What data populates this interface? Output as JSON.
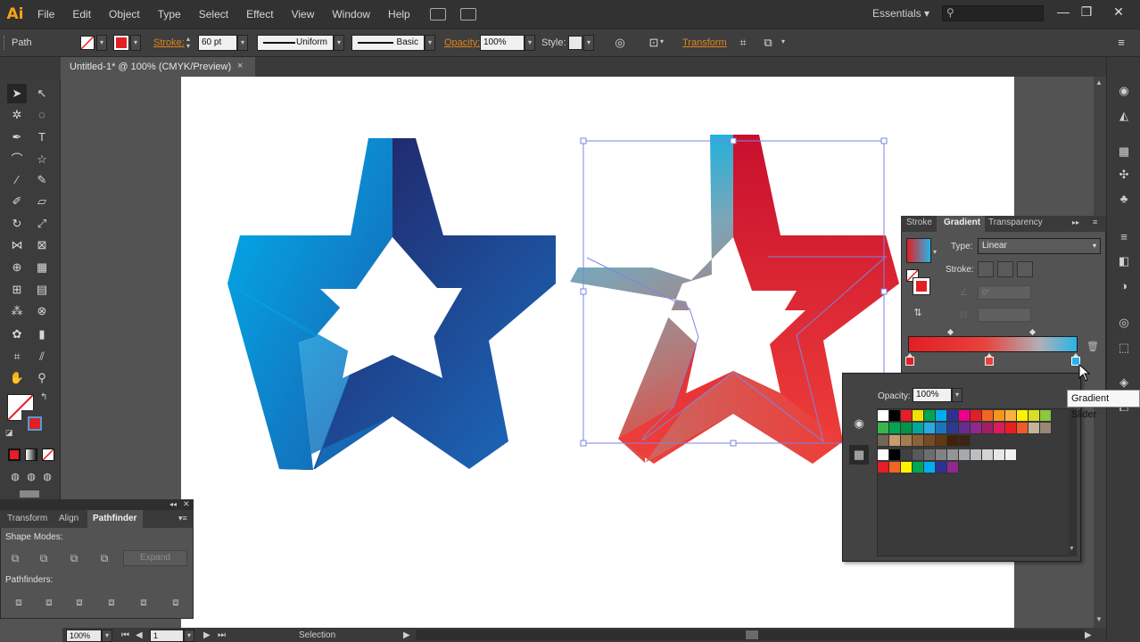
{
  "app": {
    "logo": "Ai"
  },
  "menu": [
    "File",
    "Edit",
    "Object",
    "Type",
    "Select",
    "Effect",
    "View",
    "Window",
    "Help"
  ],
  "workspace": "Essentials",
  "window_controls": [
    "—",
    "❐",
    "✕"
  ],
  "control_bar": {
    "selection_type": "Path",
    "stroke_label": "Stroke:",
    "stroke_weight": "60 pt",
    "profile": "Uniform",
    "brush": "Basic",
    "opacity_label": "Opacity:",
    "opacity": "100%",
    "style_label": "Style:",
    "transform_label": "Transform"
  },
  "document_tab": {
    "title": "Untitled-1* @ 100% (CMYK/Preview)",
    "close": "×"
  },
  "gradient_panel": {
    "tabs": [
      "Stroke",
      "Gradient",
      "Transparency"
    ],
    "type_label": "Type:",
    "type_value": "Linear",
    "stroke_label": "Stroke:",
    "angle_value": "0°",
    "stops": [
      {
        "position": 0,
        "color": "#e31e24"
      },
      {
        "position": 0.47,
        "color": "#e8423c"
      },
      {
        "position": 1.0,
        "color": "#27b4e8"
      }
    ]
  },
  "swatch_popup": {
    "opacity_label": "Opacity:",
    "opacity_value": "100%",
    "rows": [
      [
        "#ffffff",
        "#000000",
        "#e31e24",
        "#f5e000",
        "#00a651",
        "#00aeef",
        "#2e3192",
        "#ec008c",
        "#e31e24",
        "#f26522",
        "#f7941d",
        "#fbb040",
        "#fff200",
        "#d7df23",
        "#8dc63f"
      ],
      [
        "#39b54a",
        "#00a651",
        "#009444",
        "#00a79d",
        "#27aae1",
        "#1c75bc",
        "#2b3990",
        "#662d91",
        "#92278f",
        "#9e1f63",
        "#da1c5c",
        "#ed1c24",
        "#f15a29",
        "#c2b59b",
        "#998675"
      ],
      [
        "#726658",
        "#c69c6d",
        "#a67c52",
        "#8c6239",
        "#754c24",
        "#603913",
        "#42210b",
        "#3c2415"
      ],
      [
        "#ffffff",
        "#000000",
        "#414042",
        "#58595b",
        "#6d6e71",
        "#808285",
        "#939598",
        "#a7a9ac",
        "#bcbec0",
        "#d1d3d4",
        "#e6e7e8",
        "#f1f2f2"
      ],
      [
        "#e31e24",
        "#f26522",
        "#fff200",
        "#00a651",
        "#00aeef",
        "#2e3192",
        "#92278f"
      ]
    ]
  },
  "tooltip": "Gradient Slider",
  "pathfinder_panel": {
    "tabs": [
      "Transform",
      "Align",
      "Pathfinder"
    ],
    "shape_modes_label": "Shape Modes:",
    "expand_label": "Expand",
    "pathfinders_label": "Pathfinders:"
  },
  "status_bar": {
    "zoom": "100%",
    "artboard": "1",
    "tool": "Selection"
  },
  "colors": {
    "accent_orange": "#e2841a",
    "canvas": "#535353",
    "artboard": "#ffffff"
  }
}
